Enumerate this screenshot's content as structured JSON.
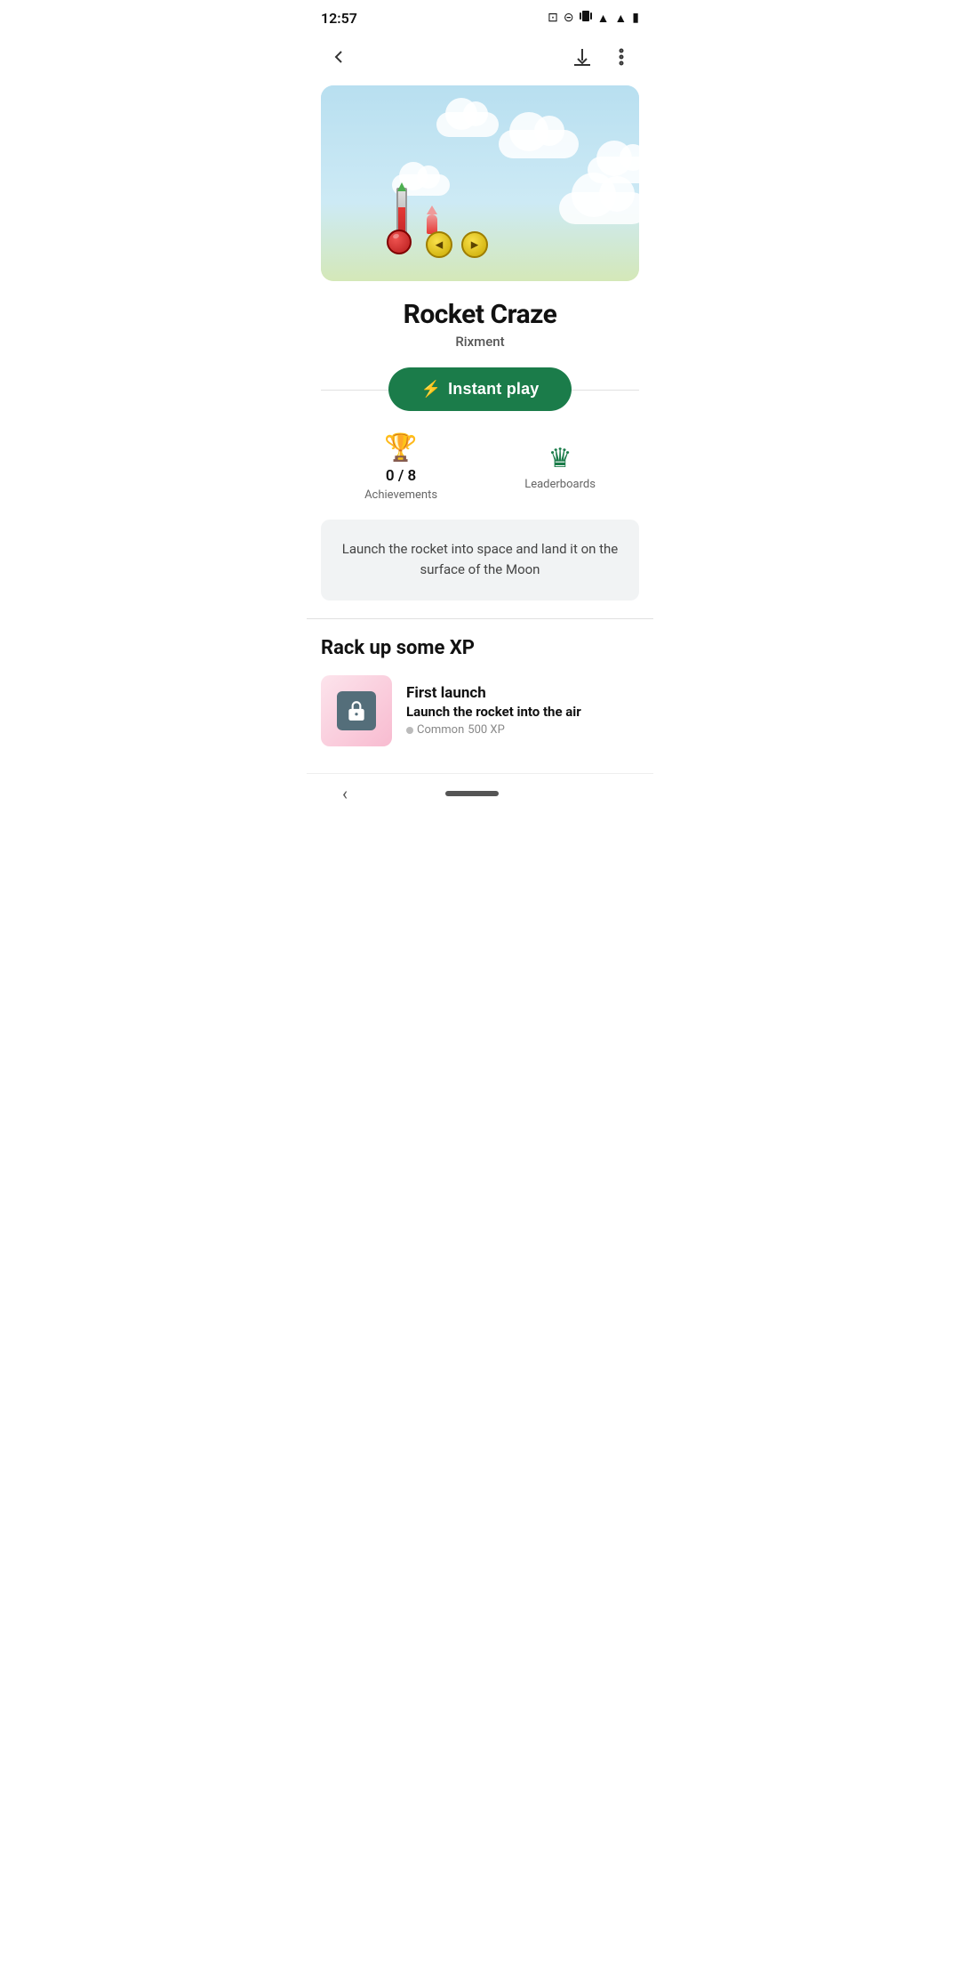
{
  "statusBar": {
    "time": "12:57",
    "icons": [
      "clipboard-icon",
      "no-entry-icon",
      "vibrate-icon",
      "wifi-icon",
      "signal-icon",
      "battery-icon"
    ]
  },
  "nav": {
    "backLabel": "←",
    "downloadLabel": "download",
    "moreLabel": "more"
  },
  "app": {
    "title": "Rocket Craze",
    "developer": "Rixment",
    "instantPlayLabel": "Instant play",
    "lightningIcon": "⚡"
  },
  "stats": {
    "achievements": {
      "icon": "🏆",
      "value": "0 / 8",
      "label": "Achievements"
    },
    "leaderboards": {
      "icon": "👑",
      "label": "Leaderboards"
    }
  },
  "description": {
    "text": "Launch the rocket into space and land it on the surface of the Moon"
  },
  "xpSection": {
    "title": "Rack up some XP",
    "items": [
      {
        "title": "First launch",
        "description": "Launch the rocket into the air",
        "rarity": "Common",
        "xp": "500 XP"
      }
    ]
  },
  "bottomNav": {
    "backLabel": "‹"
  }
}
